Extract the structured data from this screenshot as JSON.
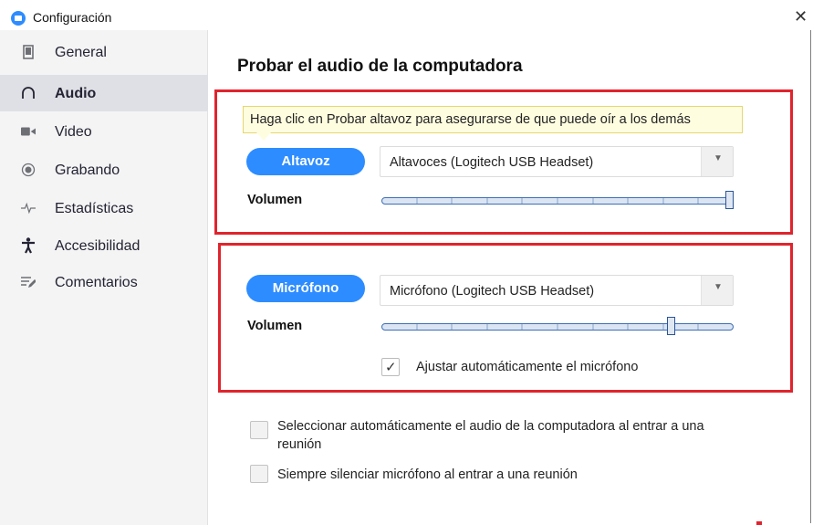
{
  "window": {
    "title": "Configuración",
    "close_glyph": "✕"
  },
  "sidebar": {
    "items": [
      {
        "label": "General",
        "icon": "general-icon",
        "active": false
      },
      {
        "label": "Audio",
        "icon": "headphones-icon",
        "active": true
      },
      {
        "label": "Video",
        "icon": "video-camera-icon",
        "active": false
      },
      {
        "label": "Grabando",
        "icon": "record-icon",
        "active": false
      },
      {
        "label": "Estadísticas",
        "icon": "statistics-icon",
        "active": false
      },
      {
        "label": "Accesibilidad",
        "icon": "accessibility-icon",
        "active": false
      },
      {
        "label": "Comentarios",
        "icon": "feedback-icon",
        "active": false
      }
    ]
  },
  "main": {
    "heading": "Probar el audio de la computadora",
    "speaker": {
      "tooltip": "Haga clic en Probar altavoz para asegurarse de que puede oír a los demás",
      "button_label": "Altavoz",
      "device": "Altavoces (Logitech USB Headset)",
      "volume_label": "Volumen",
      "volume_level": 1.0
    },
    "microphone": {
      "button_label": "Micrófono",
      "device": "Micrófono (Logitech USB Headset)",
      "volume_label": "Volumen",
      "volume_level": 0.83,
      "auto_adjust_label": "Ajustar automáticamente el micrófono",
      "auto_adjust_checked": true
    },
    "options": [
      {
        "label_line1": "Seleccionar automáticamente el audio de la computadora al entrar a una",
        "label_line2": "reunión",
        "checked": false
      },
      {
        "label_line1": "Siempre silenciar micrófono al entrar a una reunión",
        "label_line2": "",
        "checked": false
      }
    ]
  },
  "colors": {
    "accent": "#2d8cff",
    "highlight_box": "#e0242d",
    "tooltip_bg": "#fffde0"
  }
}
